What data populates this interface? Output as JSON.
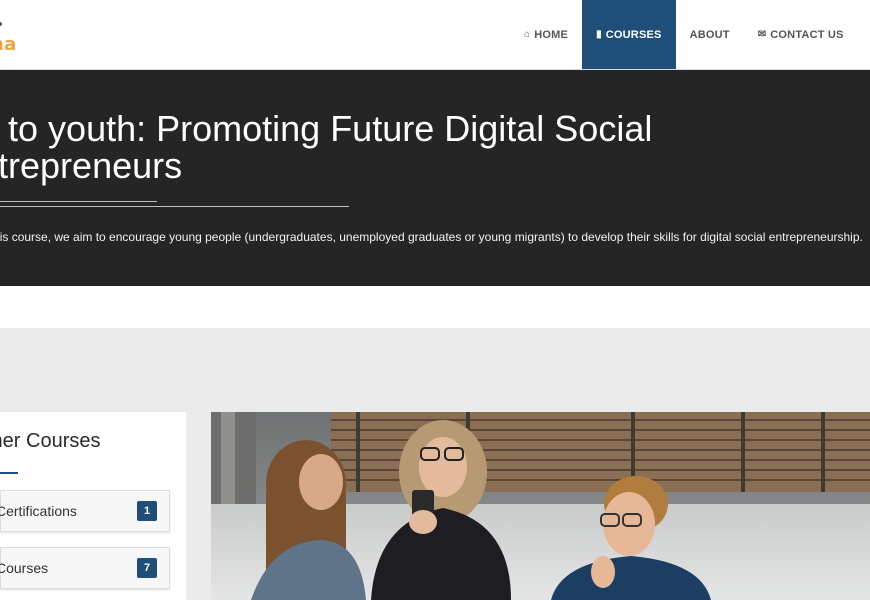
{
  "header": {
    "logo_text": "ona",
    "nav": [
      {
        "label": "HOME",
        "icon": "home-icon"
      },
      {
        "label": "COURSES",
        "icon": "book-icon",
        "active": true
      },
      {
        "label": "ABOUT"
      },
      {
        "label": "CONTACT US",
        "icon": "envelope-icon"
      }
    ]
  },
  "hero": {
    "title_line1": "p to youth: Promoting Future Digital Social",
    "title_line2": "ntrepreneurs",
    "description": "gh this course, we aim to encourage young people (undergraduates, unemployed graduates or young migrants) to develop their skills for digital social entrepreneurship."
  },
  "sidebar": {
    "title": "ther Courses",
    "items": [
      {
        "label": "Certifications",
        "count": "1"
      },
      {
        "label": "Courses",
        "count": "7"
      }
    ]
  },
  "colors": {
    "primary": "#1f4f78",
    "hero_bg": "#252525",
    "logo_accent": "#f0a23a"
  }
}
